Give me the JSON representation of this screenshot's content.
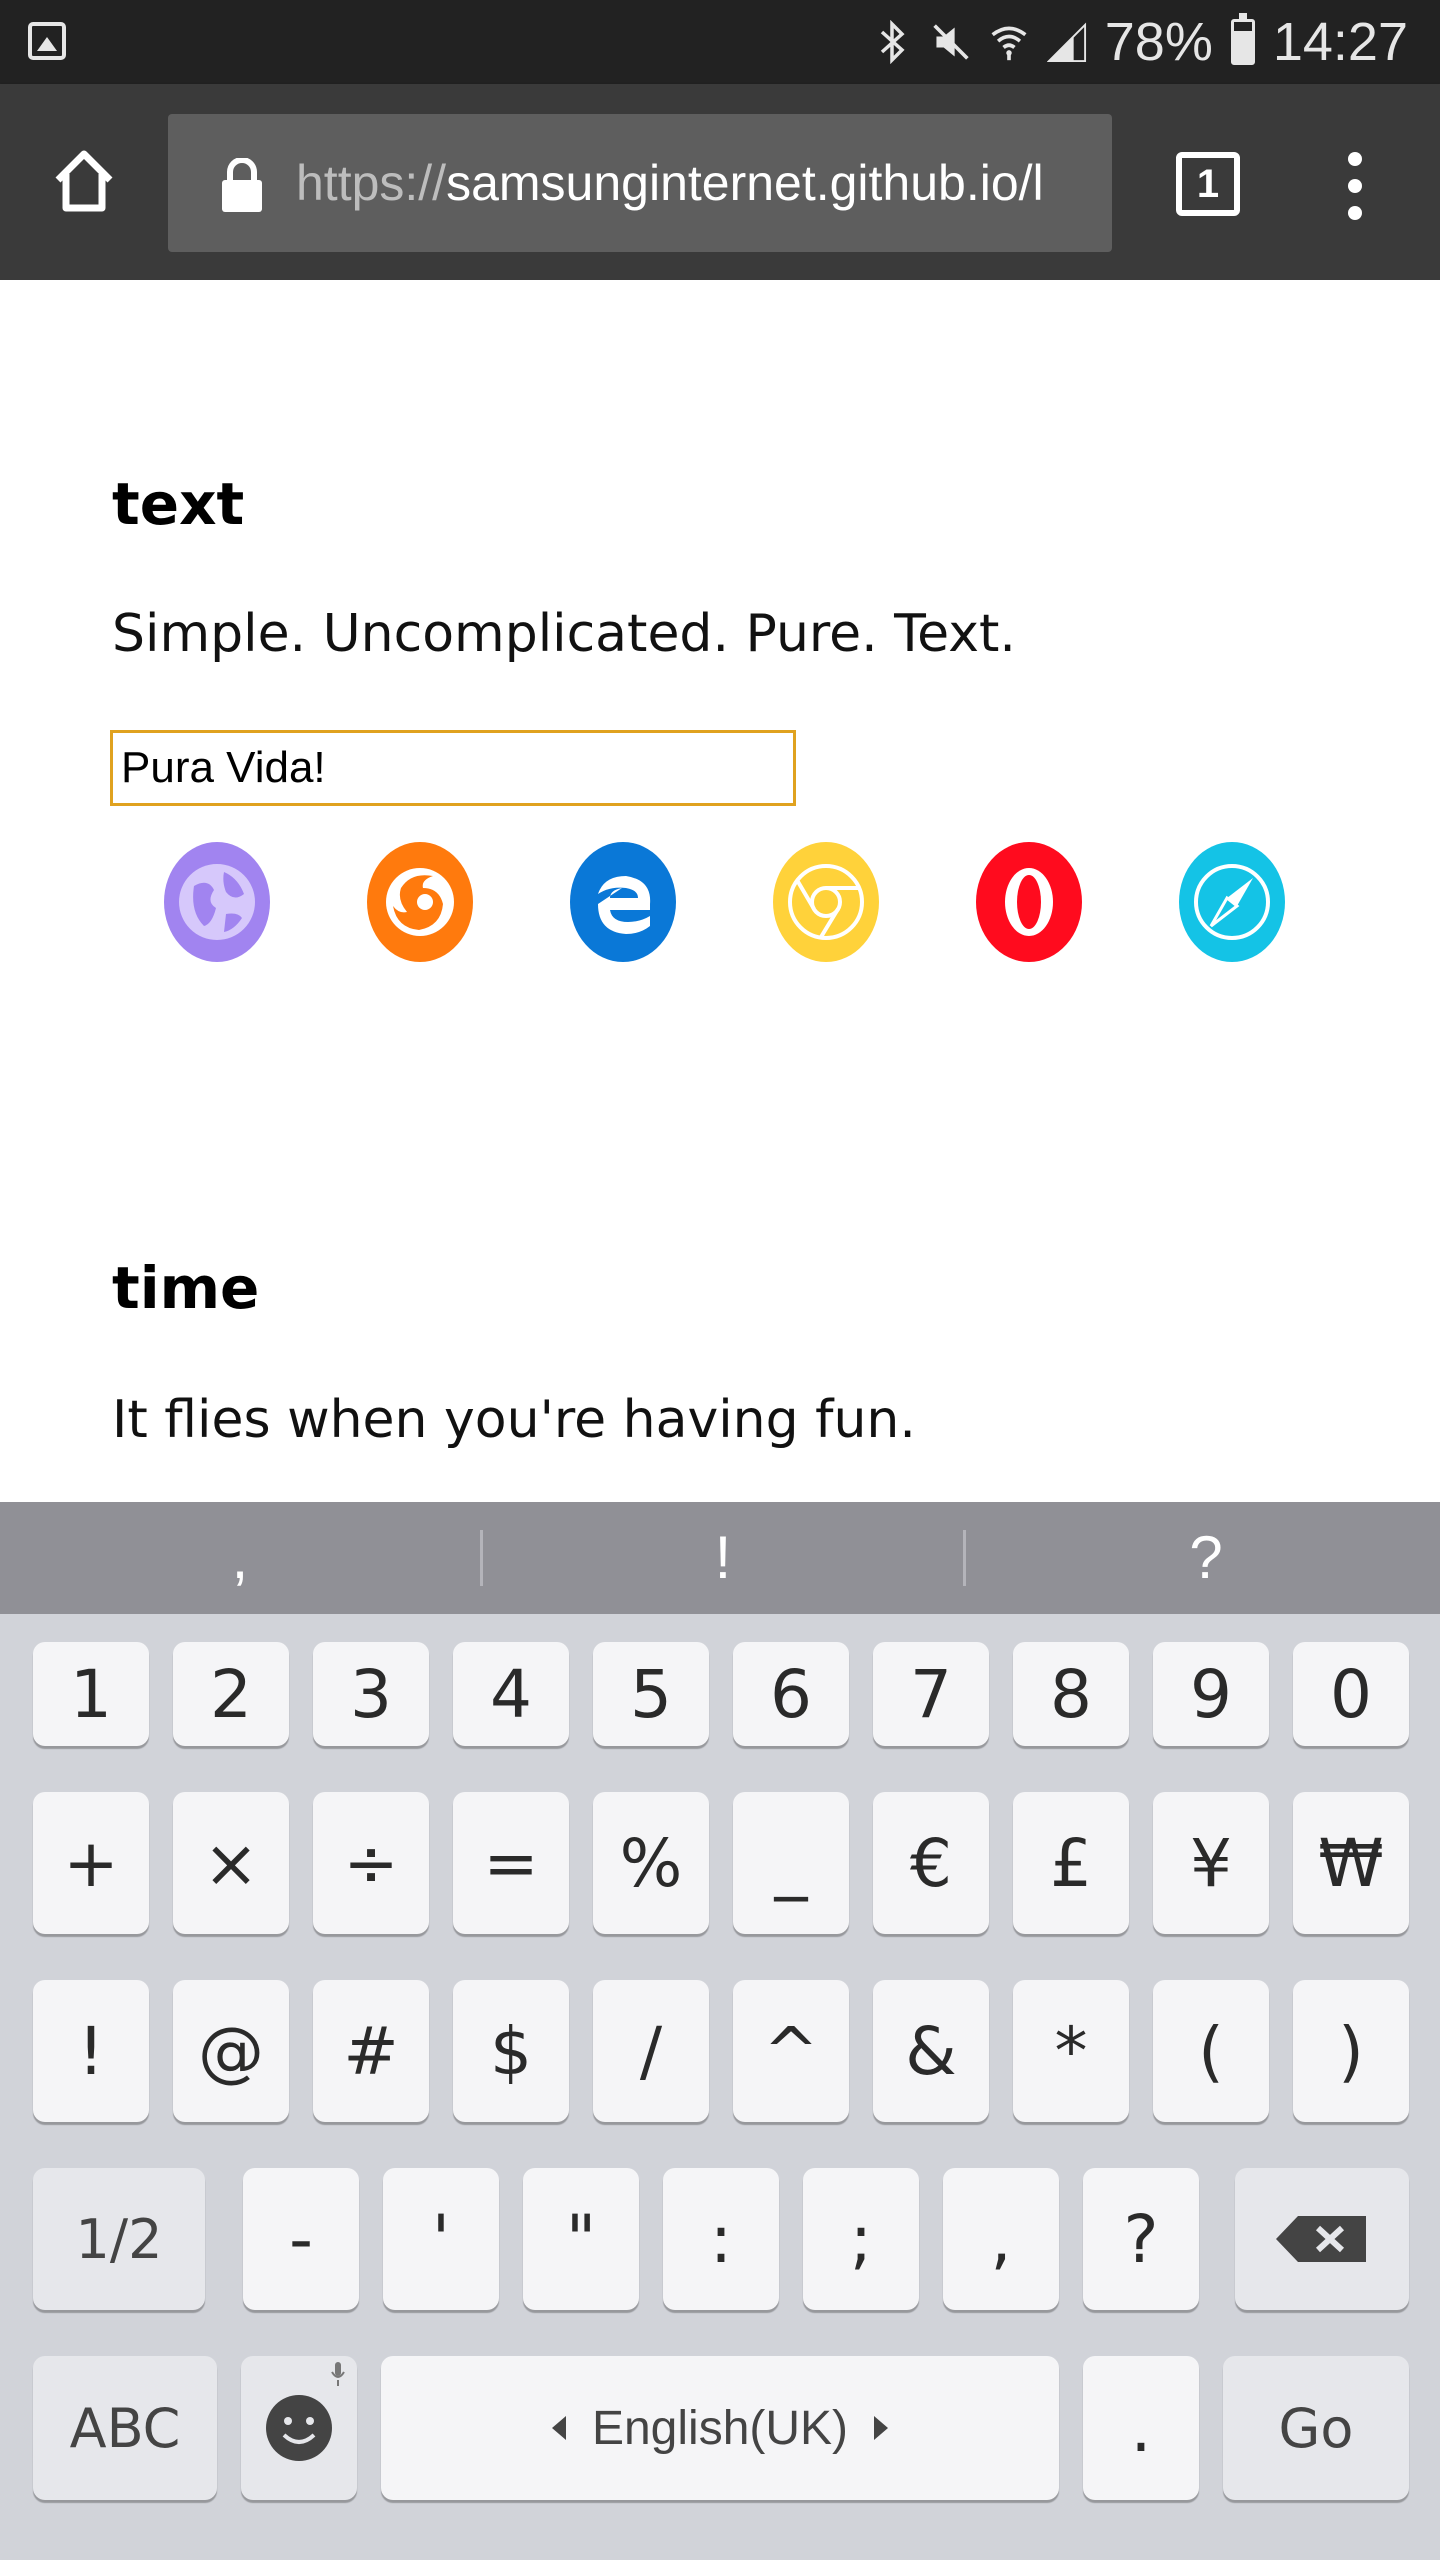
{
  "status_bar": {
    "battery_percent": "78%",
    "time": "14:27",
    "icons": [
      "gallery-icon",
      "bluetooth-icon",
      "mute-icon",
      "wifi-icon",
      "signal-icon",
      "battery-icon"
    ]
  },
  "browser": {
    "url_scheme": "https://",
    "url_rest": "samsunginternet.github.io/l",
    "tab_count": "1"
  },
  "page": {
    "section1": {
      "heading": "text",
      "description": "Simple. Uncomplicated. Pure. Text.",
      "input_value": "Pura Vida!"
    },
    "browser_icons": [
      "samsung-internet-icon",
      "firefox-icon",
      "edge-icon",
      "chrome-icon",
      "opera-icon",
      "safari-icon"
    ],
    "section2": {
      "heading": "time",
      "description": "It flies when you're having fun."
    }
  },
  "keyboard": {
    "suggestions": [
      ",",
      "!",
      "?"
    ],
    "row1": [
      "1",
      "2",
      "3",
      "4",
      "5",
      "6",
      "7",
      "8",
      "9",
      "0"
    ],
    "row2": [
      "+",
      "×",
      "÷",
      "=",
      "%",
      "_",
      "€",
      "£",
      "¥",
      "₩"
    ],
    "row3": [
      "!",
      "@",
      "#",
      "$",
      "/",
      "^",
      "&",
      "*",
      "(",
      ")"
    ],
    "row4": [
      "1/2",
      "-",
      "'",
      "\"",
      ":",
      ";",
      ",",
      "?"
    ],
    "abc_label": "ABC",
    "language": "English(UK)",
    "period": ".",
    "go_label": "Go"
  },
  "colors": {
    "status_bar": "#222222",
    "toolbar": "#3a3a3a",
    "input_border": "#e0a21f",
    "keyboard_bg": "#d1d3d9"
  }
}
